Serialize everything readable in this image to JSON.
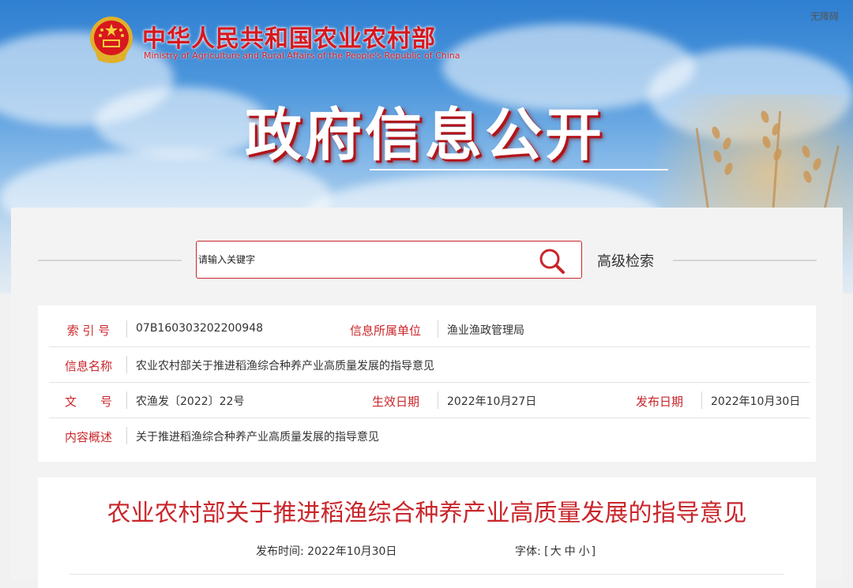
{
  "header": {
    "site_name": "中华人民共和国农业农村部",
    "site_name_en": "Ministry of Agriculture and Rural Affairs of the People's Republic of China",
    "accessibility": "无障碍",
    "section_title": "政府信息公开"
  },
  "search": {
    "placeholder": "请输入关键字",
    "advanced_label": "高级检索"
  },
  "meta": {
    "index_label": "索 引 号",
    "index_value": "07B160303202200948",
    "unit_label": "信息所属单位",
    "unit_value": "渔业渔政管理局",
    "name_label": "信息名称",
    "name_value": "农业农村部关于推进稻渔综合种养产业高质量发展的指导意见",
    "doc_label": "文　　号",
    "doc_value": "农渔发〔2022〕22号",
    "effective_label": "生效日期",
    "effective_value": "2022年10月27日",
    "publish_label": "发布日期",
    "publish_value": "2022年10月30日",
    "summary_label": "内容概述",
    "summary_value": "关于推进稻渔综合种养产业高质量发展的指导意见"
  },
  "article": {
    "title": "农业农村部关于推进稻渔综合种养产业高质量发展的指导意见",
    "publish_time_label": "发布时间:",
    "publish_time_value": "2022年10月30日",
    "font_label": "字体:",
    "font_open": "[",
    "font_large": "大",
    "font_medium": "中",
    "font_small": "小",
    "font_close": "]"
  },
  "colors": {
    "accent_red": "#c9262b",
    "text": "#333333"
  },
  "icons": {
    "emblem": "national-emblem-icon",
    "search": "search-icon"
  }
}
